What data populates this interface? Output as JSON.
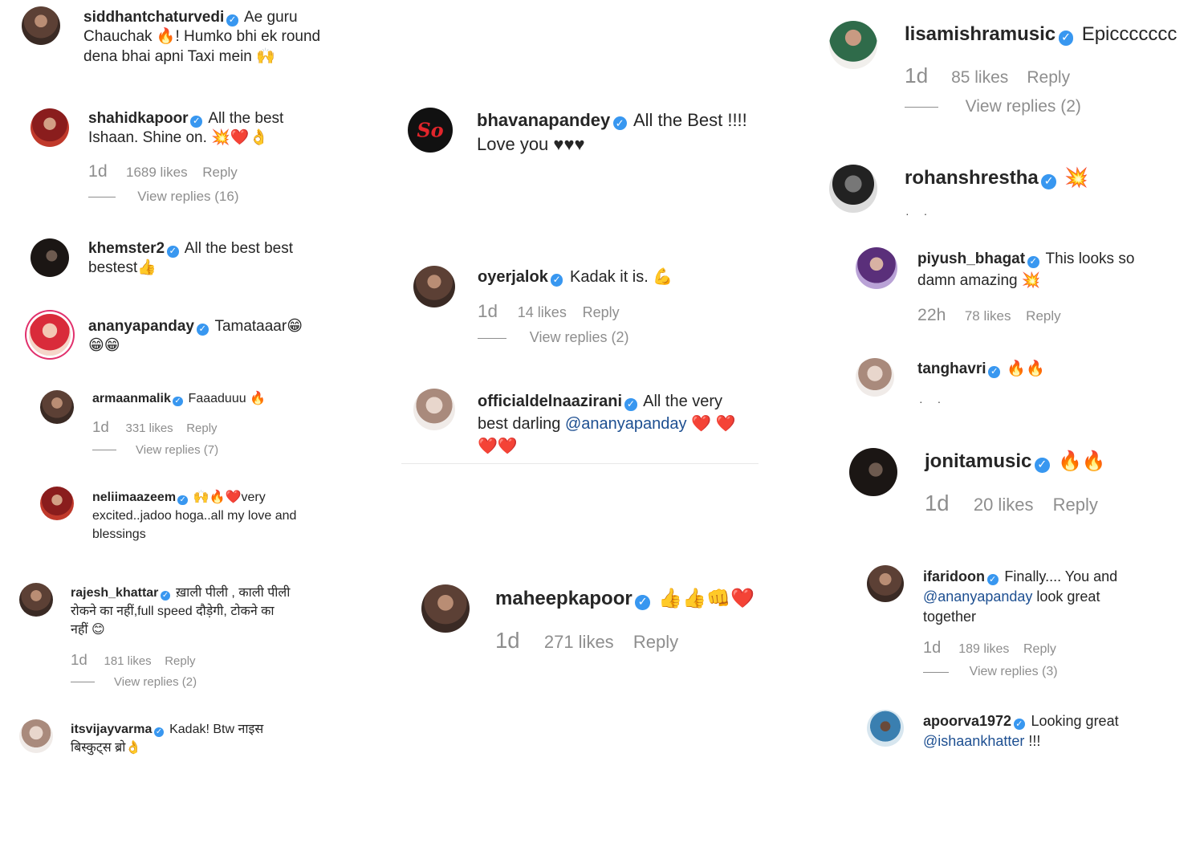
{
  "comments": {
    "c1": {
      "user": "siddhantchaturvedi",
      "text": "Ae guru Chauchak 🔥! Humko bhi ek round dena bhai apni Taxi mein 🙌"
    },
    "c2": {
      "user": "shahidkapoor",
      "text": "All the best Ishaan. Shine on. 💥❤️👌",
      "time": "1d",
      "likes": "1689 likes",
      "reply": "Reply",
      "view_replies": "View replies (16)"
    },
    "c3": {
      "user": "khemster2",
      "text": "All the best best bestest👍"
    },
    "c4": {
      "user": "ananyapanday",
      "text": "Tamataaar😁 😁😁"
    },
    "c5": {
      "user": "armaanmalik",
      "text": "Faaaduuu 🔥",
      "time": "1d",
      "likes": "331 likes",
      "reply": "Reply",
      "view_replies": "View replies (7)"
    },
    "c6": {
      "user": "neliimaazeem",
      "text": "🙌🔥❤️very excited..jadoo hoga..all my love and blessings"
    },
    "c7": {
      "user": "rajesh_khattar",
      "text": "ख़ाली पीली , काली पीली रोकने का नहीं,full speed दौड़ेगी, टोकने का नहीं 😊",
      "time": "1d",
      "likes": "181 likes",
      "reply": "Reply",
      "view_replies": "View replies (2)"
    },
    "c8": {
      "user": "itsvijayvarma",
      "text": "Kadak! Btw नाइस बिस्कुट्स ब्रो👌"
    },
    "c9": {
      "user": "bhavanapandey",
      "text": "All the Best !!!! Love you ♥♥♥",
      "avatar_text": "So"
    },
    "c10": {
      "user": "oyerjalok",
      "text": "Kadak it is. 💪",
      "time": "1d",
      "likes": "14 likes",
      "reply": "Reply",
      "view_replies": "View replies (2)"
    },
    "c11": {
      "user": "officialdelnaazirani",
      "text_before": "All the very best darling ",
      "mention": "@ananyapanday",
      "text_after": " ❤️ ❤️❤️❤️"
    },
    "c12": {
      "user": "maheepkapoor",
      "text": "👍👍👊❤️",
      "time": "1d",
      "likes": "271 likes",
      "reply": "Reply"
    },
    "c13": {
      "user": "lisamishramusic",
      "text": "Epiccccccc",
      "time": "1d",
      "likes": "85 likes",
      "reply": "Reply",
      "view_replies": "View replies (2)"
    },
    "c14": {
      "user": "rohanshrestha",
      "text": "💥"
    },
    "c15": {
      "user": "piyush_bhagat",
      "text": "This looks so damn amazing 💥",
      "time": "22h",
      "likes": "78 likes",
      "reply": "Reply"
    },
    "c16": {
      "user": "tanghavri",
      "text": "🔥🔥"
    },
    "c17": {
      "user": "jonitamusic",
      "text": "🔥🔥",
      "time": "1d",
      "likes": "20 likes",
      "reply": "Reply"
    },
    "c18": {
      "user": "ifaridoon",
      "text_before": "Finally.... You and ",
      "mention": "@ananyapanday",
      "text_after": " look great together",
      "time": "1d",
      "likes": "189 likes",
      "reply": "Reply",
      "view_replies": "View replies (3)"
    },
    "c19": {
      "user": "apoorva1972",
      "text_before": "Looking great ",
      "mention": "@ishaankhatter",
      "text_after": " !!!"
    }
  }
}
